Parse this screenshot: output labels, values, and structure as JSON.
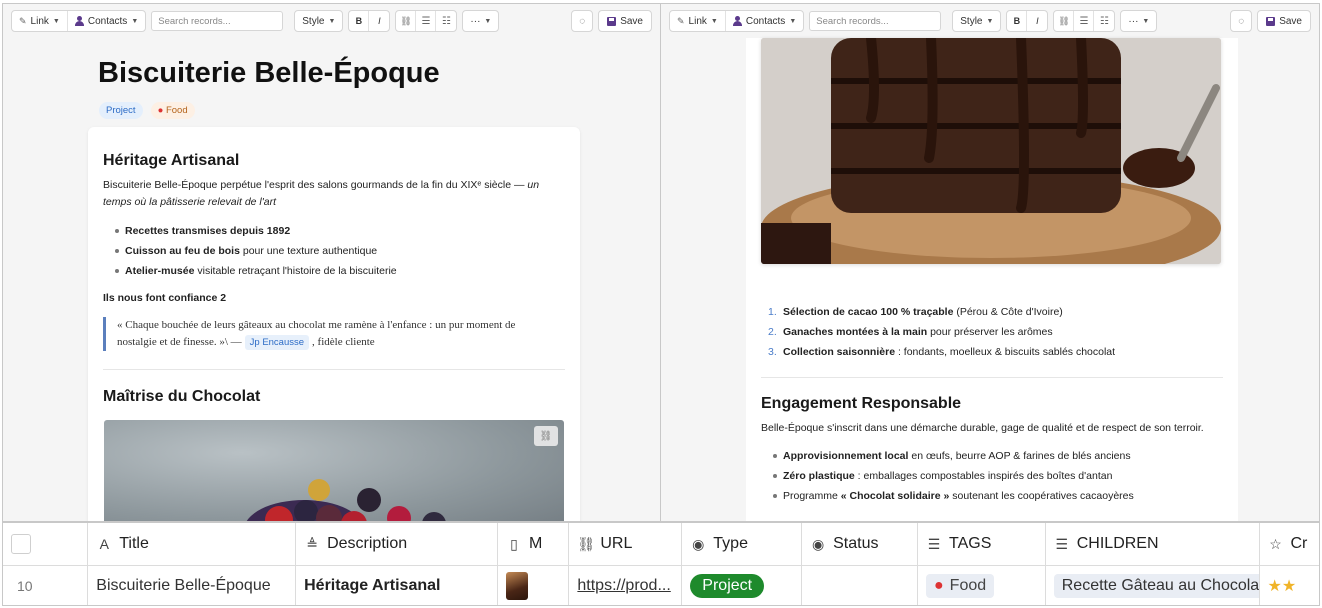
{
  "toolbar": {
    "link_label": "Link",
    "contacts_label": "Contacts",
    "search_placeholder": "Search records...",
    "style_label": "Style",
    "bold_label": "B",
    "italic_label": "I",
    "more_label": "···",
    "save_label": "Save"
  },
  "left_doc": {
    "title": "Biscuiterie Belle-Époque",
    "tags": [
      "Project",
      "Food"
    ],
    "section1": {
      "heading": "Héritage Artisanal",
      "intro": "Biscuiterie Belle-Époque perpétue l'esprit des salons gourmands de la fin du XIXᵉ siècle — ",
      "intro_em": "un temps où la pâtisserie relevait de l'art",
      "bullets": [
        {
          "bold": "Recettes transmises depuis 1892",
          "rest": ""
        },
        {
          "bold": "Cuisson au feu de bois",
          "rest": " pour une texture authentique"
        },
        {
          "bold": "Atelier-musée",
          "rest": " visitable retraçant l'histoire de la biscuiterie"
        }
      ],
      "subheading": "Ils nous font confiance 2",
      "quote": "« Chaque bouchée de leurs gâteaux au chocolat me ramène à l'enfance : un pur moment de nostalgie et de finesse. »\\ —",
      "mention": "Jp Encausse",
      "quote_tail": ", fidèle cliente"
    },
    "section2": {
      "heading": "Maîtrise du Chocolat"
    }
  },
  "right_doc": {
    "ordered": [
      {
        "bold": "Sélection de cacao 100 % traçable",
        "rest": " (Pérou & Côte d'Ivoire)"
      },
      {
        "bold": "Ganaches montées à la main",
        "rest": " pour préserver les arômes"
      },
      {
        "bold": "Collection saisonnière",
        "rest": " : fondants, moelleux & biscuits sablés chocolat"
      }
    ],
    "section3": {
      "heading": "Engagement Responsable",
      "intro": "Belle-Époque s'inscrit dans une démarche durable, gage de qualité et de respect de son terroir.",
      "bullets": [
        {
          "pre": "",
          "bold": "Approvisionnement local",
          "rest": " en œufs, beurre AOP & farines de blés anciens"
        },
        {
          "pre": "",
          "bold": "Zéro plastique",
          "rest": " : emballages compostables inspirés des boîtes d'antan"
        },
        {
          "pre": "Programme ",
          "bold": "« Chocolat solidaire »",
          "rest": " soutenant les coopératives cacaoyères"
        }
      ]
    }
  },
  "grid": {
    "columns": [
      "Title",
      "Description",
      "M",
      "URL",
      "Type",
      "Status",
      "TAGS",
      "CHILDREN",
      "Cr"
    ],
    "row": {
      "index": "10",
      "title": "Biscuiterie Belle-Époque",
      "description": "Héritage Artisanal",
      "url": "https://prod...",
      "type": "Project",
      "status": "",
      "tag": "Food",
      "child": "Recette Gâteau au Chocolat",
      "rating_stars": 2
    }
  },
  "colors": {
    "accent": "#5b3a8c",
    "project_pill": "#1e8a2c",
    "link_blue": "#2d6cc6"
  }
}
